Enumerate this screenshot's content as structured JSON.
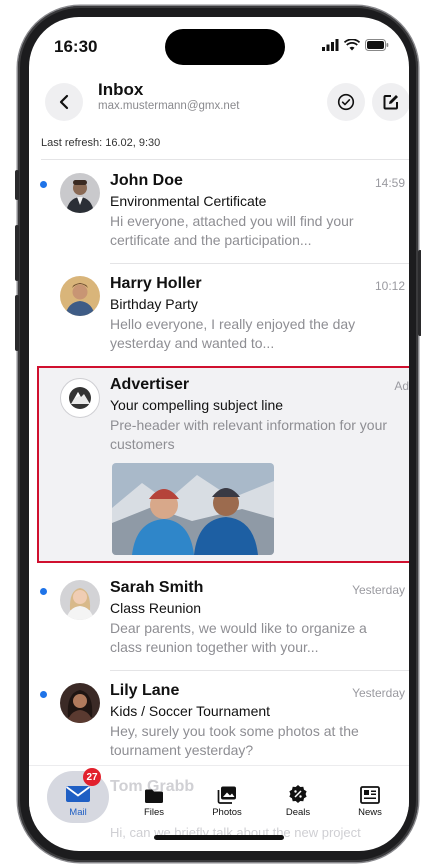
{
  "status": {
    "time": "16:30"
  },
  "header": {
    "title": "Inbox",
    "account": "max.mustermann@gmx.net"
  },
  "refresh": "Last refresh: 16.02, 9:30",
  "messages": [
    {
      "sender": "John Doe",
      "subject": "Environmental Certificate",
      "preview": "Hi everyone, attached you will find your certificate and the participation...",
      "time": "14:59",
      "unread": true
    },
    {
      "sender": "Harry Holler",
      "subject": "Birthday Party",
      "preview": "Hello everyone, I really enjoyed the day yesterday and wanted to...",
      "time": "10:12",
      "unread": false
    },
    {
      "sender": "Sarah Smith",
      "subject": "Class Reunion",
      "preview": "Dear parents, we would like to organize a class reunion together with your...",
      "time": "Yesterday",
      "unread": true
    },
    {
      "sender": "Lily Lane",
      "subject": "Kids / Soccer Tournament",
      "preview": "Hey, surely you took some photos at the tournament yesterday?",
      "time": "Yesterday",
      "unread": true
    }
  ],
  "ad": {
    "sender": "Advertiser",
    "subject": "Your compelling subject line",
    "preview": "Pre-header with relevant information for your customers",
    "tag": "Ad"
  },
  "partial": {
    "sender": "Tom Grabb",
    "preview": "Hi, can we briefly talk about the new project"
  },
  "tabs": [
    {
      "label": "Mail",
      "icon": "mail-icon",
      "badge": "27"
    },
    {
      "label": "Files",
      "icon": "folder-icon"
    },
    {
      "label": "Photos",
      "icon": "photos-icon"
    },
    {
      "label": "Deals",
      "icon": "deals-icon"
    },
    {
      "label": "News",
      "icon": "news-icon"
    }
  ],
  "colors": {
    "accent": "#1e73e8",
    "ad_border": "#d0102f",
    "badge": "#e2202c"
  }
}
